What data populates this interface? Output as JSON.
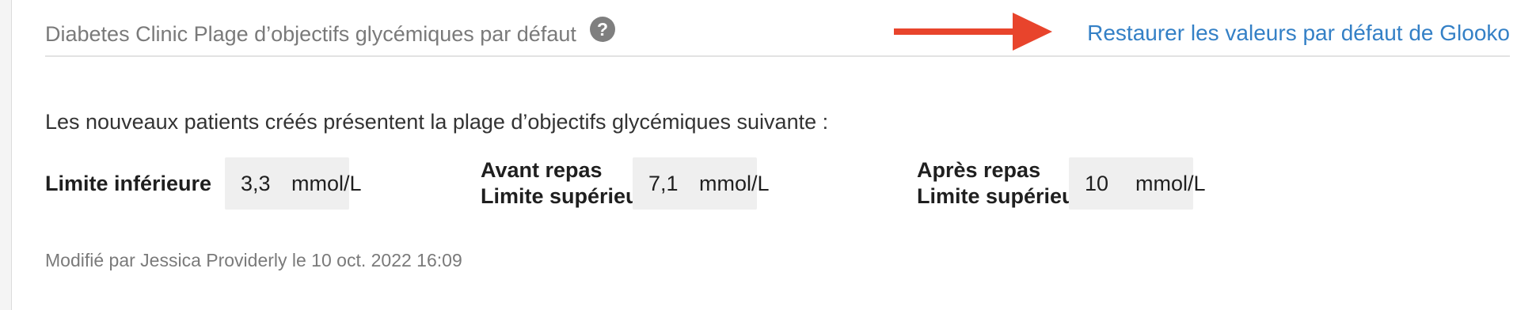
{
  "header": {
    "title": "Diabetes Clinic Plage d’objectifs glycémiques par défaut",
    "help_icon": "?",
    "restore_link": "Restaurer les valeurs par défaut de Glooko",
    "arrow_color": "#e8442c"
  },
  "intro": "Les nouveaux patients créés présentent la plage d’objectifs glycémiques suivante :",
  "limits": [
    {
      "label_line1": "Limite inférieure",
      "label_line2": "",
      "value": "3,3",
      "unit": "mmol/L"
    },
    {
      "label_line1": "Avant repas",
      "label_line2": "Limite supérieure",
      "value": "7,1",
      "unit": "mmol/L"
    },
    {
      "label_line1": "Après repas",
      "label_line2": "Limite supérieure",
      "value": "10",
      "unit": "mmol/L"
    }
  ],
  "modified": "Modifié par Jessica Providerly le 10 oct. 2022 16:09",
  "colors": {
    "link": "#3480c6",
    "input_bg": "#efefef",
    "muted_text": "#7a7a7a"
  }
}
